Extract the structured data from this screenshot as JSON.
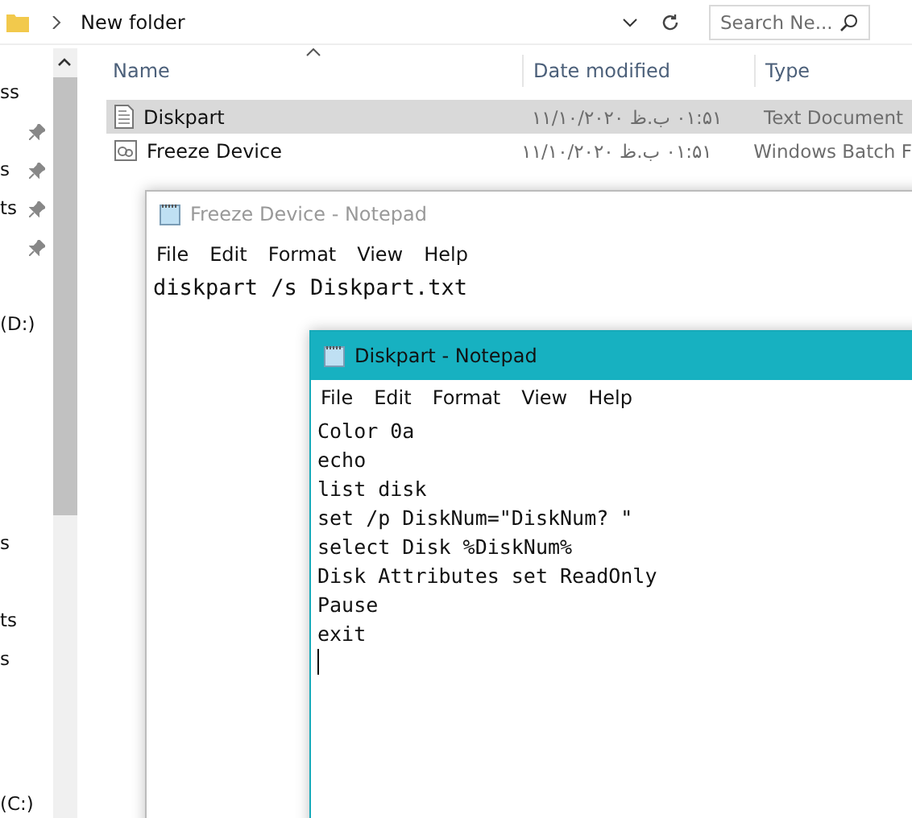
{
  "explorer": {
    "address": "New folder",
    "search_placeholder": "Search Ne...",
    "sidebar_items": [
      {
        "label": "ss",
        "pinned": false
      },
      {
        "pinned": true
      },
      {
        "label": "s",
        "pinned": true
      },
      {
        "label": "ts",
        "pinned": true
      },
      {
        "pinned": true
      },
      {
        "label": "(D:)",
        "pinned": false
      },
      {
        "label": "s",
        "pinned": false
      },
      {
        "label": "ts",
        "pinned": false
      },
      {
        "label": "s",
        "pinned": false
      },
      {
        "label": "(C:)",
        "pinned": false
      }
    ],
    "columns": [
      "Name",
      "Date modified",
      "Type"
    ],
    "files": [
      {
        "name": "Diskpart",
        "date": "۰۱:۵۱ ب.ظ ۱۱/۱۰/۲۰۲۰",
        "type": "Text Document",
        "kind": "text",
        "selected": true
      },
      {
        "name": "Freeze Device",
        "date": "۰۱:۵۱ ب.ظ ۱۱/۱۰/۲۰۲۰",
        "type": "Windows Batch F",
        "kind": "batch",
        "selected": false
      }
    ]
  },
  "notepads": [
    {
      "title": "Freeze Device - Notepad",
      "active": false,
      "menu": [
        "File",
        "Edit",
        "Format",
        "View",
        "Help"
      ],
      "lines": [
        "diskpart /s Diskpart.txt"
      ],
      "caret": false
    },
    {
      "title": "Diskpart - Notepad",
      "active": true,
      "menu": [
        "File",
        "Edit",
        "Format",
        "View",
        "Help"
      ],
      "lines": [
        "Color 0a",
        "echo",
        "list disk",
        "set /p DiskNum=\"DiskNum? \"",
        "select Disk %DiskNum%",
        "Disk Attributes set ReadOnly",
        "Pause",
        "exit"
      ],
      "caret": true
    }
  ]
}
